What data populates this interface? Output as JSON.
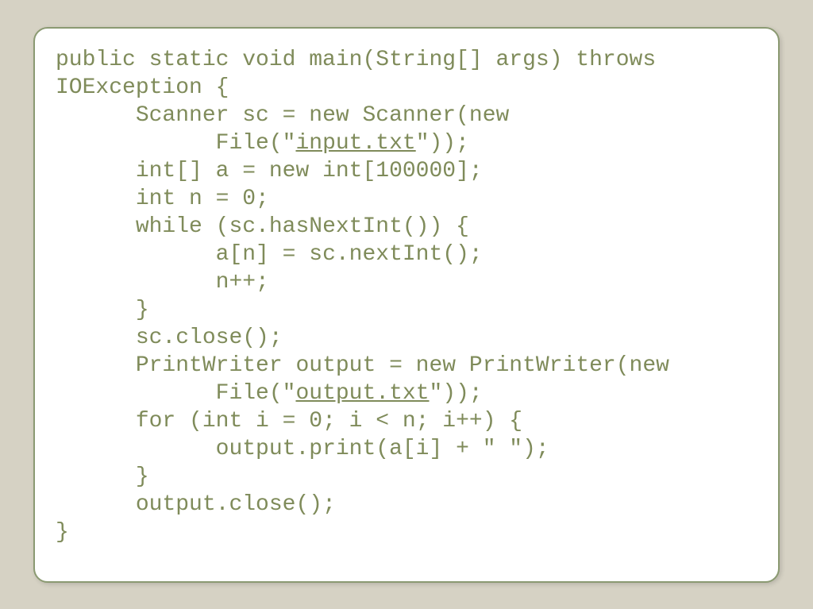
{
  "code": {
    "l1": "public static void main(String[] args) throws",
    "l2": "IOException {",
    "l3": "      Scanner sc = new Scanner(new",
    "l4a": "            File(\"",
    "l4link": "input.txt",
    "l4b": "\"));",
    "l5": "      int[] a = new int[100000];",
    "l6": "      int n = 0;",
    "l7": "      while (sc.hasNextInt()) {",
    "l8": "            a[n] = sc.nextInt();",
    "l9": "            n++;",
    "l10": "      }",
    "l11": "      sc.close();",
    "l12": "      PrintWriter output = new PrintWriter(new",
    "l13a": "            File(\"",
    "l13link": "output.txt",
    "l13b": "\"));",
    "l14": "      for (int i = 0; i < n; i++) {",
    "l15": "            output.print(a[i] + \" \");",
    "l16": "      }",
    "l17": "      output.close();",
    "l18": "}"
  }
}
